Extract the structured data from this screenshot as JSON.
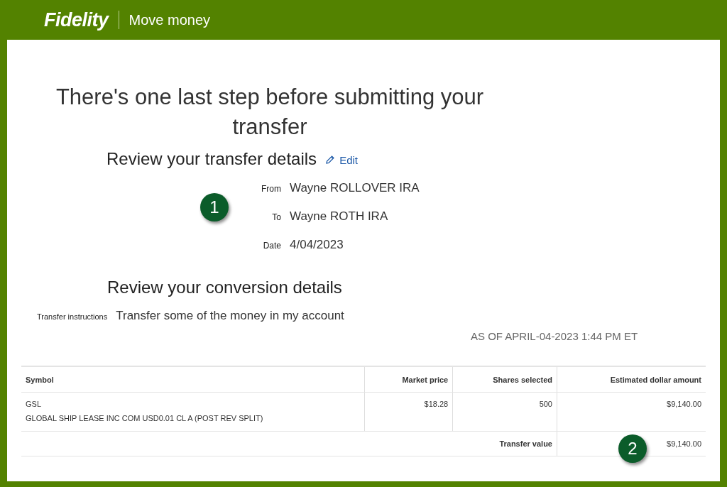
{
  "header": {
    "logo": "Fidelity",
    "title": "Move money"
  },
  "page_title": "There's one last step before submitting your transfer",
  "transfer_section": {
    "heading": "Review your transfer details",
    "edit_link": "Edit",
    "details": [
      {
        "label": "From",
        "value": "Wayne ROLLOVER IRA"
      },
      {
        "label": "To",
        "value": "Wayne ROTH IRA"
      },
      {
        "label": "Date",
        "value": "4/04/2023"
      }
    ]
  },
  "conversion_section": {
    "heading": "Review your conversion details",
    "instructions_label": "Transfer instructions",
    "instructions_value": "Transfer some of the money in my account",
    "as_of": "AS OF APRIL-04-2023 1:44 PM ET"
  },
  "table": {
    "columns": [
      "Symbol",
      "Market price",
      "Shares selected",
      "Estimated dollar amount"
    ],
    "rows": [
      {
        "symbol": "GSL",
        "description": "GLOBAL SHIP LEASE INC COM USD0.01 CL A (POST REV SPLIT)",
        "market_price": "$18.28",
        "shares": "500",
        "amount": "$9,140.00"
      }
    ],
    "total_label": "Transfer value",
    "total_value": "$9,140.00"
  },
  "callouts": [
    {
      "label": "1"
    },
    {
      "label": "2"
    }
  ]
}
